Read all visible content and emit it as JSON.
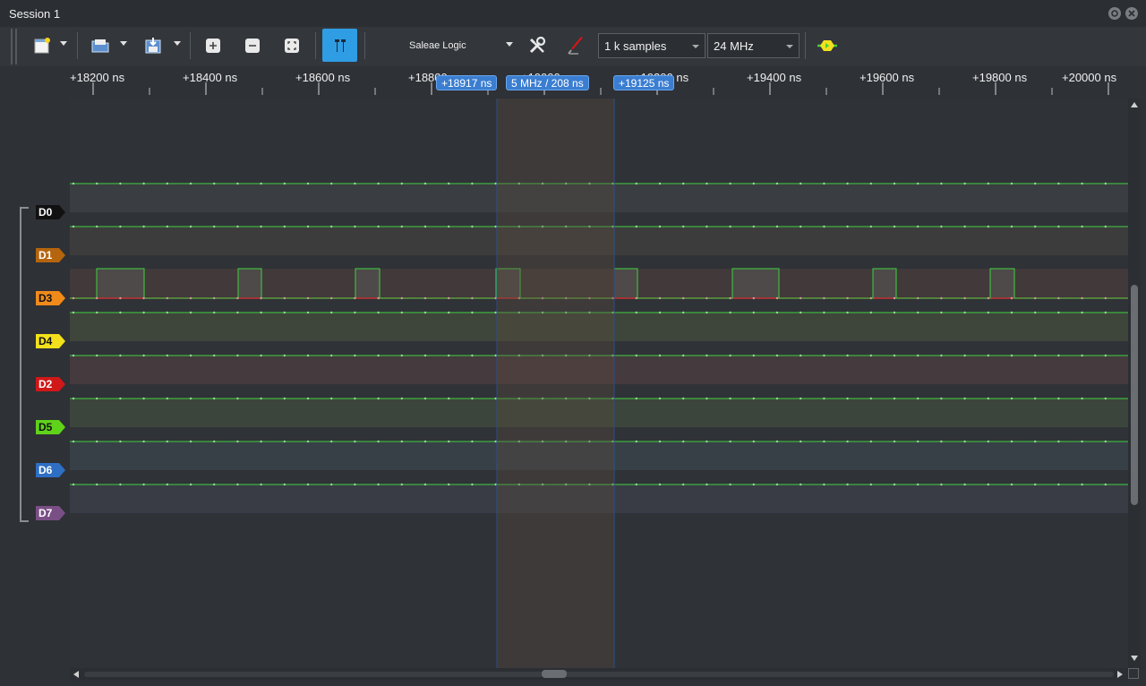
{
  "window": {
    "title": "Session 1",
    "pin_icon": "pin-icon",
    "close_icon": "close-icon"
  },
  "toolbar": {
    "device_name": "Saleae Logic",
    "samples_value": "1 k samples",
    "rate_value": "24 MHz",
    "icons": [
      "new-session-icon",
      "open-icon",
      "save-export-icon",
      "zoom-in-icon",
      "zoom-out-icon",
      "zoom-fit-icon",
      "cursor-marker-icon",
      "settings-tools-icon",
      "probe-icon",
      "run-capture-icon"
    ]
  },
  "ruler": {
    "tick_labels": [
      "+18200 ns",
      "+18400 ns",
      "+18600 ns",
      "+18800 ns",
      "+19000 ns",
      "+19200 ns",
      "+19400 ns",
      "+19600 ns",
      "+19800 ns",
      "+20000 ns"
    ],
    "marker_a": "+18917 ns",
    "marker_delta": "5 MHz / 208 ns",
    "marker_b": "+19125 ns"
  },
  "channels": [
    {
      "name": "D0",
      "color": "#111111",
      "text_color": "#ffffff"
    },
    {
      "name": "D1",
      "color": "#b5650e",
      "text_color": "#ffffff"
    },
    {
      "name": "D3",
      "color": "#f08a1a",
      "text_color": "#111111"
    },
    {
      "name": "D4",
      "color": "#f2e01c",
      "text_color": "#111111"
    },
    {
      "name": "D2",
      "color": "#d01818",
      "text_color": "#ffffff"
    },
    {
      "name": "D5",
      "color": "#5fd21a",
      "text_color": "#111111"
    },
    {
      "name": "D6",
      "color": "#2e6fc4",
      "text_color": "#ffffff"
    },
    {
      "name": "D7",
      "color": "#7a4f86",
      "text_color": "#ffffff"
    }
  ],
  "colors": {
    "signal_high_line": "#3fd13f",
    "signal_low_line": "#e03030",
    "selection_overlay": "#5a4a3e"
  }
}
